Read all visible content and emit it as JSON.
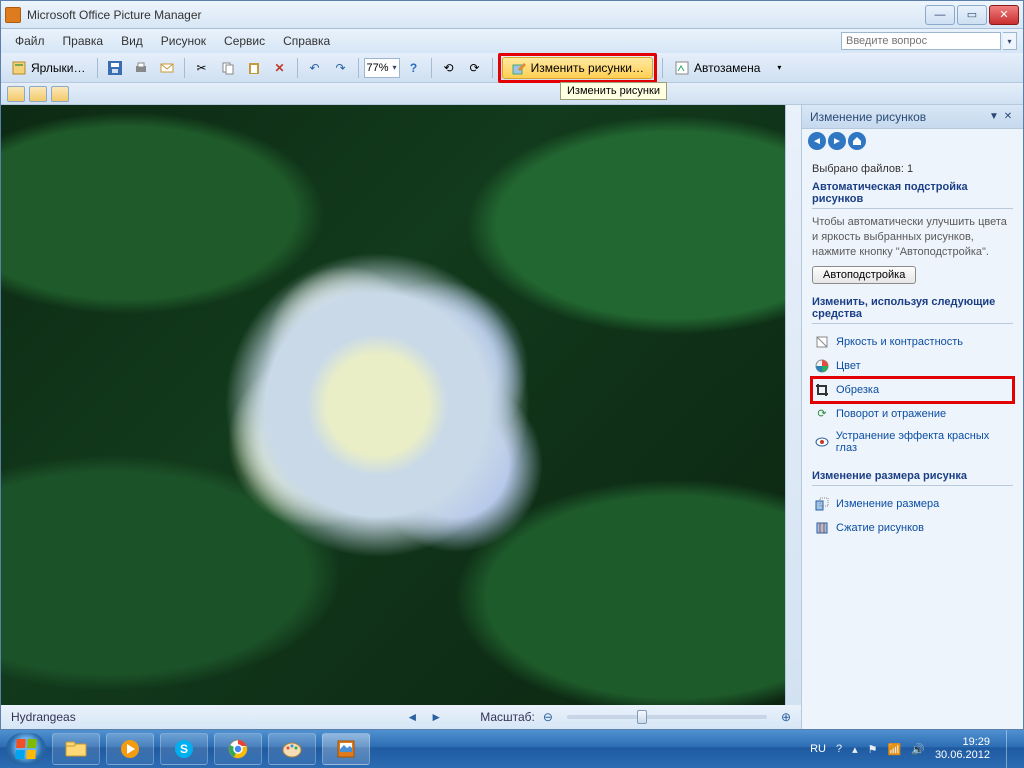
{
  "titlebar": {
    "title": "Microsoft Office Picture Manager"
  },
  "menubar": {
    "items": [
      "Файл",
      "Правка",
      "Вид",
      "Рисунок",
      "Сервис",
      "Справка"
    ],
    "ask_placeholder": "Введите вопрос"
  },
  "toolbar": {
    "shortcuts_label": "Ярлыки…",
    "zoom_value": "77%",
    "edit_pictures_label": "Изменить рисунки…",
    "auto_correct_label": "Автозамена"
  },
  "tooltip": {
    "edit_pictures": "Изменить рисунки"
  },
  "status": {
    "filename": "Hydrangeas",
    "zoom_label": "Масштаб:"
  },
  "pane": {
    "title": "Изменение рисунков",
    "selected_label": "Выбрано файлов:",
    "selected_count": "1",
    "auto_section_title": "Автоматическая подстройка рисунков",
    "auto_desc": "Чтобы автоматически улучшить цвета и яркость выбранных рисунков, нажмите кнопку \"Автоподстройка\".",
    "auto_button": "Автоподстройка",
    "tools_section_title": "Изменить, используя следующие средства",
    "tools": [
      {
        "id": "brightness",
        "label": "Яркость и контрастность"
      },
      {
        "id": "color",
        "label": "Цвет"
      },
      {
        "id": "crop",
        "label": "Обрезка"
      },
      {
        "id": "rotate",
        "label": "Поворот и отражение"
      },
      {
        "id": "redeye",
        "label": "Устранение эффекта красных глаз"
      }
    ],
    "resize_section_title": "Изменение размера рисунка",
    "resize_tools": [
      {
        "id": "resize",
        "label": "Изменение размера"
      },
      {
        "id": "compress",
        "label": "Сжатие рисунков"
      }
    ]
  },
  "taskbar": {
    "lang": "RU",
    "time": "19:29",
    "date": "30.06.2012"
  }
}
